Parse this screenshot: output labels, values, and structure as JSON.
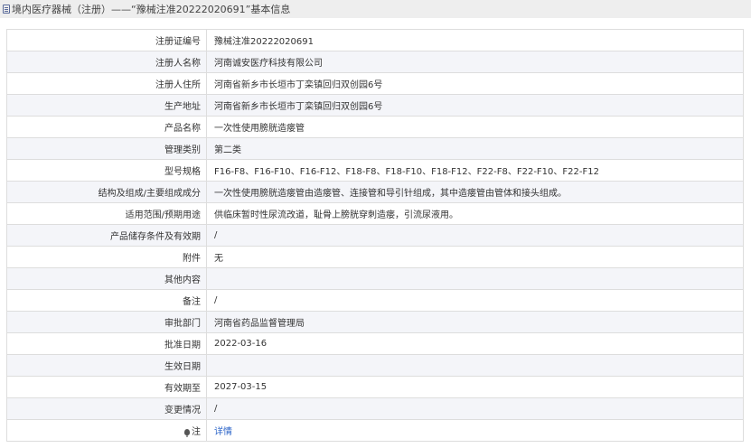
{
  "header": {
    "title": "境内医疗器械（注册）——“豫械注准20222020691”基本信息"
  },
  "rows": [
    {
      "label": "注册证编号",
      "value": "豫械注准20222020691"
    },
    {
      "label": "注册人名称",
      "value": "河南诚安医疗科技有限公司"
    },
    {
      "label": "注册人住所",
      "value": "河南省新乡市长垣市丁栾镇回归双创园6号"
    },
    {
      "label": "生产地址",
      "value": "河南省新乡市长垣市丁栾镇回归双创园6号"
    },
    {
      "label": "产品名称",
      "value": "一次性使用膀胱造瘘管"
    },
    {
      "label": "管理类别",
      "value": "第二类"
    },
    {
      "label": "型号规格",
      "value": "F16-F8、F16-F10、F16-F12、F18-F8、F18-F10、F18-F12、F22-F8、F22-F10、F22-F12"
    },
    {
      "label": "结构及组成/主要组成成分",
      "value": "一次性使用膀胱造瘘管由造瘘管、连接管和导引针组成，其中造瘘管由管体和接头组成。"
    },
    {
      "label": "适用范围/预期用途",
      "value": "供临床暂时性尿流改道，耻骨上膀胱穿刺造瘘，引流尿液用。"
    },
    {
      "label": "产品储存条件及有效期",
      "value": "/"
    },
    {
      "label": "附件",
      "value": "无"
    },
    {
      "label": "其他内容",
      "value": ""
    },
    {
      "label": "备注",
      "value": "/"
    },
    {
      "label": "审批部门",
      "value": "河南省药品监督管理局"
    },
    {
      "label": "批准日期",
      "value": "2022-03-16"
    },
    {
      "label": "生效日期",
      "value": ""
    },
    {
      "label": "有效期至",
      "value": "2027-03-15"
    },
    {
      "label": "变更情况",
      "value": "/"
    }
  ],
  "note_row": {
    "label": "注",
    "link": "详情"
  }
}
